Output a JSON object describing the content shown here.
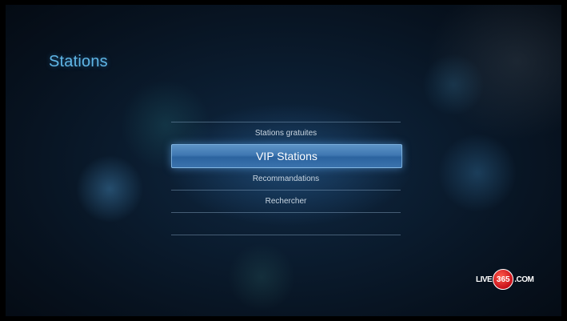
{
  "screen": {
    "title": "Stations"
  },
  "menu": {
    "items": [
      {
        "label": "Stations gratuites"
      },
      {
        "label": "VIP Stations",
        "selected": true
      },
      {
        "label": "Recommandations"
      },
      {
        "label": "Rechercher"
      }
    ]
  },
  "brand": {
    "prefix": "LIVE",
    "number": "365",
    "suffix": ".COM"
  },
  "colors": {
    "accent": "#5fb6e6",
    "selection": "#3f78b2",
    "logo_red": "#d0141e"
  }
}
